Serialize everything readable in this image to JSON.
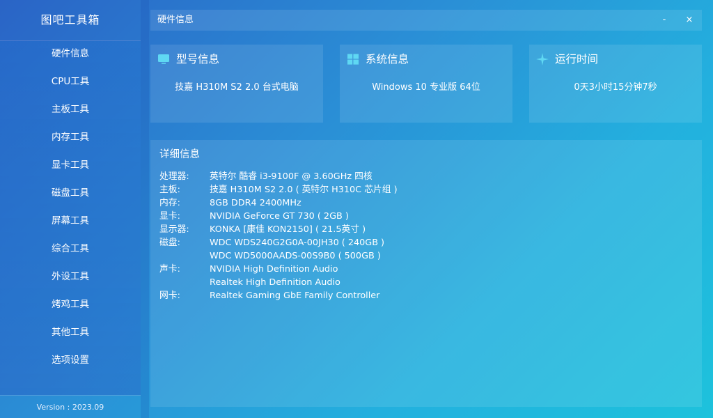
{
  "app": {
    "title": "图吧工具箱",
    "version": "Version : 2023.09"
  },
  "sidebar": {
    "items": [
      {
        "label": "硬件信息"
      },
      {
        "label": "CPU工具"
      },
      {
        "label": "主板工具"
      },
      {
        "label": "内存工具"
      },
      {
        "label": "显卡工具"
      },
      {
        "label": "磁盘工具"
      },
      {
        "label": "屏幕工具"
      },
      {
        "label": "综合工具"
      },
      {
        "label": "外设工具"
      },
      {
        "label": "烤鸡工具"
      },
      {
        "label": "其他工具"
      },
      {
        "label": "选项设置"
      }
    ]
  },
  "titlebar": {
    "title": "硬件信息",
    "minimize": "-",
    "close": "×"
  },
  "cards": [
    {
      "title": "型号信息",
      "value": "技嘉  H310M S2 2.0 台式电脑",
      "icon": "monitor-icon"
    },
    {
      "title": "系统信息",
      "value": "Windows 10 专业版 64位",
      "icon": "windows-icon"
    },
    {
      "title": "运行时间",
      "value": "0天3小时15分钟7秒",
      "icon": "sparkle-icon"
    }
  ],
  "details": {
    "title": "详细信息",
    "rows": [
      {
        "label": "处理器:",
        "value": "英特尔 酷睿 i3-9100F @ 3.60GHz 四核"
      },
      {
        "label": "主板:",
        "value": "技嘉 H310M S2 2.0 ( 英特尔 H310C 芯片组 )"
      },
      {
        "label": "内存:",
        "value": "8GB DDR4 2400MHz"
      },
      {
        "label": "显卡:",
        "value": "NVIDIA GeForce GT 730 ( 2GB )"
      },
      {
        "label": "显示器:",
        "value": "KONKA [康佳 KON2150] ( 21.5英寸 )"
      },
      {
        "label": "磁盘:",
        "value": "WDC WDS240G2G0A-00JH30 ( 240GB )"
      },
      {
        "label": "",
        "value": "WDC WD5000AADS-00S9B0 ( 500GB )"
      },
      {
        "label": "声卡:",
        "value": "NVIDIA High Definition Audio"
      },
      {
        "label": "",
        "value": "Realtek High Definition Audio"
      },
      {
        "label": "网卡:",
        "value": "Realtek Gaming GbE Family Controller"
      }
    ]
  },
  "colors": {
    "gradient_start": "#2a64c6",
    "gradient_end": "#1dc2dc",
    "icon_accent": "#5fd8f3"
  }
}
